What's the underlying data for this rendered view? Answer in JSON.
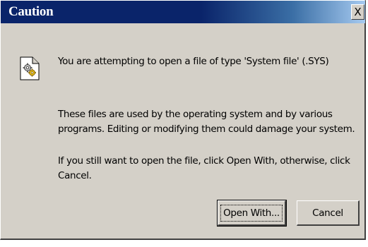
{
  "window": {
    "title": "Caution",
    "close_label": "X"
  },
  "icon": {
    "name": "system-file-icon"
  },
  "message": {
    "line1": "You are attempting to open a file of type 'System file' (.SYS)",
    "paragraph2": [
      "These files are used by the operating system and by various",
      "programs. Editing or modifying them could damage your system."
    ],
    "paragraph3": [
      "If you still want to open the file, click Open With, otherwise, click",
      "Cancel."
    ]
  },
  "buttons": {
    "open_with_label": "Open With...",
    "cancel_label": "Cancel"
  },
  "colors": {
    "titlebar_start": "#0a246a",
    "titlebar_end": "#a6caf0",
    "dialog_face": "#d4d0c8"
  }
}
